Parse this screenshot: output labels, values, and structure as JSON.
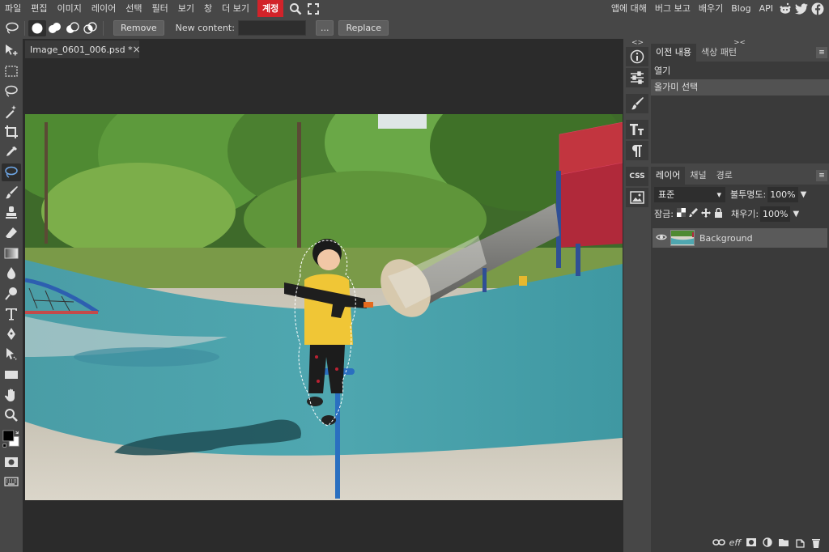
{
  "menu": {
    "items": [
      "파일",
      "편집",
      "이미지",
      "레이어",
      "선택",
      "필터",
      "보기",
      "창",
      "더 보기"
    ],
    "account": "계정",
    "right_items": [
      "앱에 대해",
      "버그 보고",
      "배우기",
      "Blog",
      "API"
    ]
  },
  "options": {
    "remove_label": "Remove",
    "new_content_label": "New content:",
    "new_content_value": "",
    "ellipsis_label": "...",
    "replace_label": "Replace"
  },
  "document": {
    "tab_title": "Image_0601_006.psd *",
    "close": "×"
  },
  "mini_panel": {
    "arrows": "<>",
    "css_label": "CSS"
  },
  "history_panel": {
    "tabs": [
      "이전 내용",
      "색상 패턴"
    ],
    "arrows": "><",
    "rows": [
      "열기",
      "올가미 선택"
    ]
  },
  "layers_panel": {
    "tabs": [
      "레이어",
      "채널",
      "경로"
    ],
    "blend_mode": "표준",
    "opacity_label": "불투명도:",
    "opacity_value": "100%",
    "lock_label": "잠금:",
    "fill_label": "채우기:",
    "fill_value": "100%",
    "layers": [
      {
        "name": "Background",
        "visible": true
      }
    ],
    "bottom_link": "eff"
  },
  "colors": {
    "accent": "#d2232a",
    "bg": "#474747",
    "panel": "#3a3a3a",
    "canvas_bg": "#2b2b2b"
  }
}
